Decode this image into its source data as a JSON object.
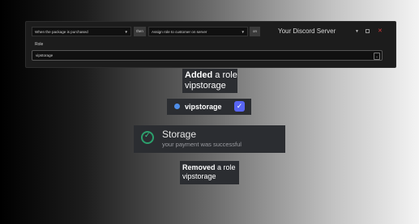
{
  "rule_panel": {
    "trigger_select": "When the package is purchased",
    "then_label": "then",
    "action_select": "Assign role to customer on server",
    "on_label": "on",
    "server_name": "Your Discord Server",
    "role_label": "Role",
    "role_value": "vipstorage"
  },
  "added_notice": {
    "bold": "Added",
    "rest": " a role",
    "role": "vipstorage"
  },
  "role_chip": {
    "name": "vipstorage",
    "checked": true,
    "dot_color": "#4f8ee8"
  },
  "payment_toast": {
    "title": "Storage",
    "subtitle": "your payment was successful",
    "accent": "#2c9f6c"
  },
  "removed_notice": {
    "bold": "Removed",
    "rest": " a role",
    "role": "vipstorage"
  }
}
